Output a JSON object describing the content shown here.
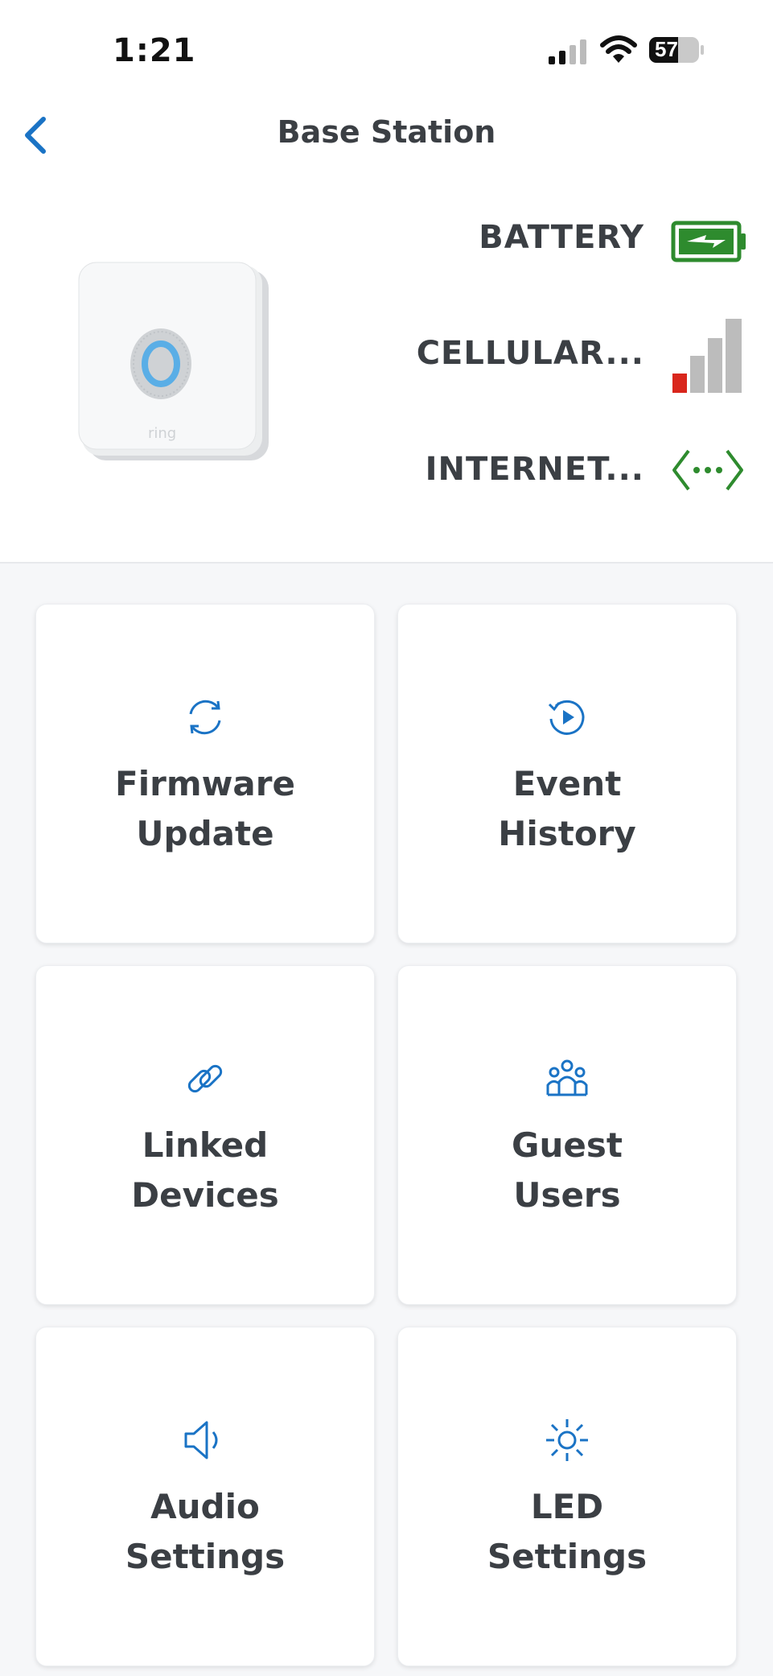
{
  "status_bar": {
    "time": "1:21",
    "battery_level": "57"
  },
  "header": {
    "title": "Base Station"
  },
  "device": {
    "logo_text": "ring"
  },
  "status": [
    {
      "label": "BATTERY",
      "icon": "battery-charging-icon",
      "color": "#2e8b2e"
    },
    {
      "label": "CELLULAR...",
      "icon": "cellular-signal-icon",
      "color": "#d9261c"
    },
    {
      "label": "INTERNET...",
      "icon": "internet-connection-icon",
      "color": "#2e8b2e"
    }
  ],
  "tiles": [
    {
      "line1": "Firmware",
      "line2": "Update",
      "icon": "refresh-icon"
    },
    {
      "line1": "Event",
      "line2": "History",
      "icon": "history-play-icon"
    },
    {
      "line1": "Linked",
      "line2": "Devices",
      "icon": "link-icon"
    },
    {
      "line1": "Guest",
      "line2": "Users",
      "icon": "users-group-icon"
    },
    {
      "line1": "Audio",
      "line2": "Settings",
      "icon": "speaker-icon"
    },
    {
      "line1": "LED",
      "line2": "Settings",
      "icon": "sun-icon"
    }
  ],
  "colors": {
    "accent": "#1a73c5",
    "text": "#3b3f44"
  }
}
